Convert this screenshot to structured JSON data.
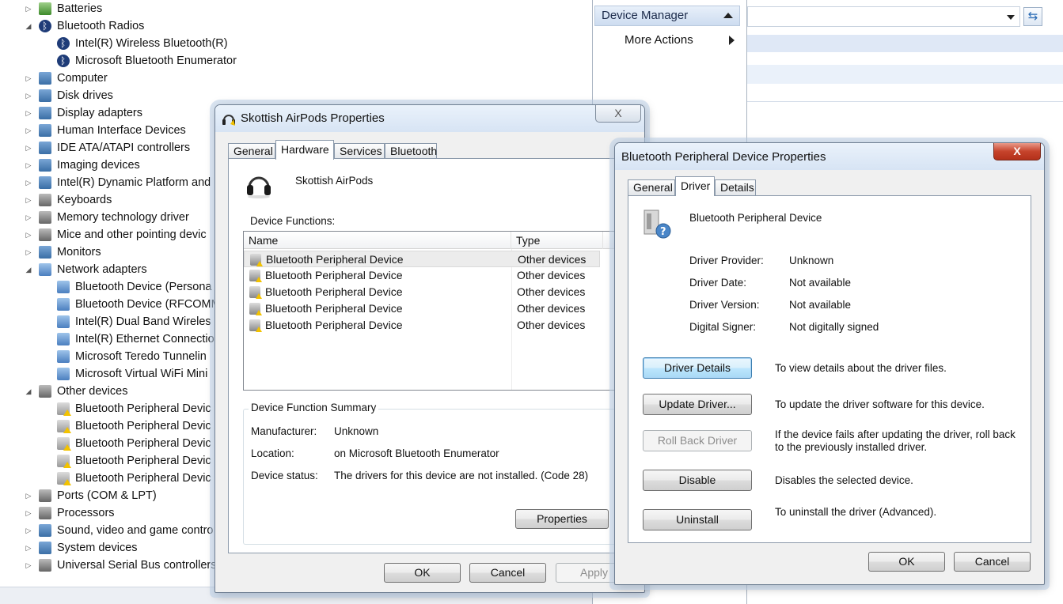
{
  "tree": {
    "items": [
      {
        "label": "Batteries",
        "level": 1,
        "expander": "closed",
        "icon": "battery-icon"
      },
      {
        "label": "Bluetooth Radios",
        "level": 1,
        "expander": "open",
        "icon": "bluetooth-icon"
      },
      {
        "label": "Intel(R) Wireless Bluetooth(R)",
        "level": 2,
        "expander": "none",
        "icon": "bluetooth-icon"
      },
      {
        "label": "Microsoft Bluetooth Enumerator",
        "level": 2,
        "expander": "none",
        "icon": "bluetooth-icon"
      },
      {
        "label": "Computer",
        "level": 1,
        "expander": "closed",
        "icon": "computer-icon"
      },
      {
        "label": "Disk drives",
        "level": 1,
        "expander": "closed",
        "icon": "disk-drive-icon"
      },
      {
        "label": "Display adapters",
        "level": 1,
        "expander": "closed",
        "icon": "display-adapter-icon"
      },
      {
        "label": "Human Interface Devices",
        "level": 1,
        "expander": "closed",
        "icon": "hid-icon"
      },
      {
        "label": "IDE ATA/ATAPI controllers",
        "level": 1,
        "expander": "closed",
        "icon": "ide-controller-icon"
      },
      {
        "label": "Imaging devices",
        "level": 1,
        "expander": "closed",
        "icon": "camera-icon"
      },
      {
        "label": "Intel(R) Dynamic Platform and",
        "level": 1,
        "expander": "closed",
        "icon": "chip-icon"
      },
      {
        "label": "Keyboards",
        "level": 1,
        "expander": "closed",
        "icon": "keyboard-icon"
      },
      {
        "label": "Memory technology driver",
        "level": 1,
        "expander": "closed",
        "icon": "memory-icon"
      },
      {
        "label": "Mice and other pointing devic",
        "level": 1,
        "expander": "closed",
        "icon": "mouse-icon"
      },
      {
        "label": "Monitors",
        "level": 1,
        "expander": "closed",
        "icon": "monitor-icon"
      },
      {
        "label": "Network adapters",
        "level": 1,
        "expander": "open",
        "icon": "network-icon"
      },
      {
        "label": "Bluetooth Device (Persona",
        "level": 2,
        "expander": "none",
        "icon": "network-adapter-icon"
      },
      {
        "label": "Bluetooth Device (RFCOMM",
        "level": 2,
        "expander": "none",
        "icon": "network-adapter-icon"
      },
      {
        "label": "Intel(R) Dual Band Wireles",
        "level": 2,
        "expander": "none",
        "icon": "network-adapter-icon"
      },
      {
        "label": "Intel(R) Ethernet Connectio",
        "level": 2,
        "expander": "none",
        "icon": "network-adapter-icon"
      },
      {
        "label": "Microsoft Teredo Tunnelin",
        "level": 2,
        "expander": "none",
        "icon": "network-adapter-icon"
      },
      {
        "label": "Microsoft Virtual WiFi Mini",
        "level": 2,
        "expander": "none",
        "icon": "network-adapter-icon"
      },
      {
        "label": "Other devices",
        "level": 1,
        "expander": "open",
        "icon": "unknown-device-icon"
      },
      {
        "label": "Bluetooth Peripheral Devic",
        "level": 2,
        "expander": "none",
        "icon": "warning-device-icon"
      },
      {
        "label": "Bluetooth Peripheral Devic",
        "level": 2,
        "expander": "none",
        "icon": "warning-device-icon"
      },
      {
        "label": "Bluetooth Peripheral Devic",
        "level": 2,
        "expander": "none",
        "icon": "warning-device-icon"
      },
      {
        "label": "Bluetooth Peripheral Devic",
        "level": 2,
        "expander": "none",
        "icon": "warning-device-icon"
      },
      {
        "label": "Bluetooth Peripheral Devic",
        "level": 2,
        "expander": "none",
        "icon": "warning-device-icon"
      },
      {
        "label": "Ports (COM & LPT)",
        "level": 1,
        "expander": "closed",
        "icon": "port-icon"
      },
      {
        "label": "Processors",
        "level": 1,
        "expander": "closed",
        "icon": "processor-icon"
      },
      {
        "label": "Sound, video and game contro",
        "level": 1,
        "expander": "closed",
        "icon": "sound-icon"
      },
      {
        "label": "System devices",
        "level": 1,
        "expander": "closed",
        "icon": "system-device-icon"
      },
      {
        "label": "Universal Serial Bus controllers",
        "level": 1,
        "expander": "closed",
        "icon": "usb-icon"
      }
    ]
  },
  "actions": {
    "header": "Device Manager",
    "more_actions": "More Actions"
  },
  "dialog1": {
    "title": "Skottish AirPods Properties",
    "close_label": "X",
    "tabs": [
      "General",
      "Hardware",
      "Services",
      "Bluetooth"
    ],
    "active_tab": "Hardware",
    "device_name": "Skottish AirPods",
    "device_functions_label": "Device Functions:",
    "columns": [
      "Name",
      "Type"
    ],
    "rows": [
      {
        "name": "Bluetooth Peripheral Device",
        "type": "Other devices"
      },
      {
        "name": "Bluetooth Peripheral Device",
        "type": "Other devices"
      },
      {
        "name": "Bluetooth Peripheral Device",
        "type": "Other devices"
      },
      {
        "name": "Bluetooth Peripheral Device",
        "type": "Other devices"
      },
      {
        "name": "Bluetooth Peripheral Device",
        "type": "Other devices"
      }
    ],
    "summary": {
      "title": "Device Function Summary",
      "manufacturer_label": "Manufacturer:",
      "manufacturer_value": "Unknown",
      "location_label": "Location:",
      "location_value": "on Microsoft Bluetooth Enumerator",
      "status_label": "Device status:",
      "status_value": "The drivers for this device are not installed. (Code 28)"
    },
    "properties_button": "Properties",
    "ok_button": "OK",
    "cancel_button": "Cancel",
    "apply_button": "Apply"
  },
  "dialog2": {
    "title": "Bluetooth Peripheral Device Properties",
    "close_label": "X",
    "tabs": [
      "General",
      "Driver",
      "Details"
    ],
    "active_tab": "Driver",
    "device_name": "Bluetooth Peripheral Device",
    "fields": [
      {
        "label": "Driver Provider:",
        "value": "Unknown"
      },
      {
        "label": "Driver Date:",
        "value": "Not available"
      },
      {
        "label": "Driver Version:",
        "value": "Not available"
      },
      {
        "label": "Digital Signer:",
        "value": "Not digitally signed"
      }
    ],
    "buttons": [
      {
        "label": "Driver Details",
        "desc": "To view details about the driver files.",
        "state": "focus"
      },
      {
        "label": "Update Driver...",
        "desc": "To update the driver software for this device.",
        "state": "normal"
      },
      {
        "label": "Roll Back Driver",
        "desc": "If the device fails after updating the driver, roll back to the previously installed driver.",
        "state": "disabled"
      },
      {
        "label": "Disable",
        "desc": "Disables the selected device.",
        "state": "normal"
      },
      {
        "label": "Uninstall",
        "desc": "To uninstall the driver (Advanced).",
        "state": "normal"
      }
    ],
    "ok_button": "OK",
    "cancel_button": "Cancel"
  }
}
